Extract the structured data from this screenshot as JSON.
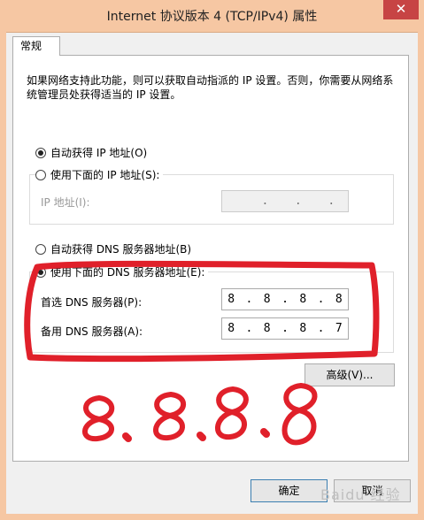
{
  "window": {
    "title": "Internet 协议版本 4 (TCP/IPv4) 属性",
    "close_symbol": "✕"
  },
  "tabs": [
    {
      "label": "常规"
    }
  ],
  "description": "如果网络支持此功能，则可以获取自动指派的 IP 设置。否则，你需要从网络系统管理员处获得适当的 IP 设置。",
  "ip_section": {
    "auto_label": "自动获得 IP 地址(O)",
    "auto_checked": true,
    "manual_label": "使用下面的 IP 地址(S):",
    "manual_checked": false,
    "ip_address_label": "IP 地址(I):",
    "ip_address_value": [
      " ",
      ".",
      ".",
      "."
    ]
  },
  "dns_section": {
    "auto_label": "自动获得 DNS 服务器地址(B)",
    "auto_checked": false,
    "manual_label": "使用下面的 DNS 服务器地址(E):",
    "manual_checked": true,
    "preferred_label": "首选 DNS 服务器(P):",
    "preferred_value": [
      "8",
      ".",
      "8",
      ".",
      "8",
      ".",
      "8"
    ],
    "alternate_label": "备用 DNS 服务器(A):",
    "alternate_value": [
      "8",
      ".",
      "8",
      ".",
      "8",
      ".",
      "7"
    ]
  },
  "buttons": {
    "advanced": "高级(V)...",
    "ok": "确定",
    "cancel": "取消"
  },
  "annotation": {
    "handwritten_text": "8.8.8.8",
    "color": "#e0202a"
  },
  "watermark": "Baidu 经验"
}
